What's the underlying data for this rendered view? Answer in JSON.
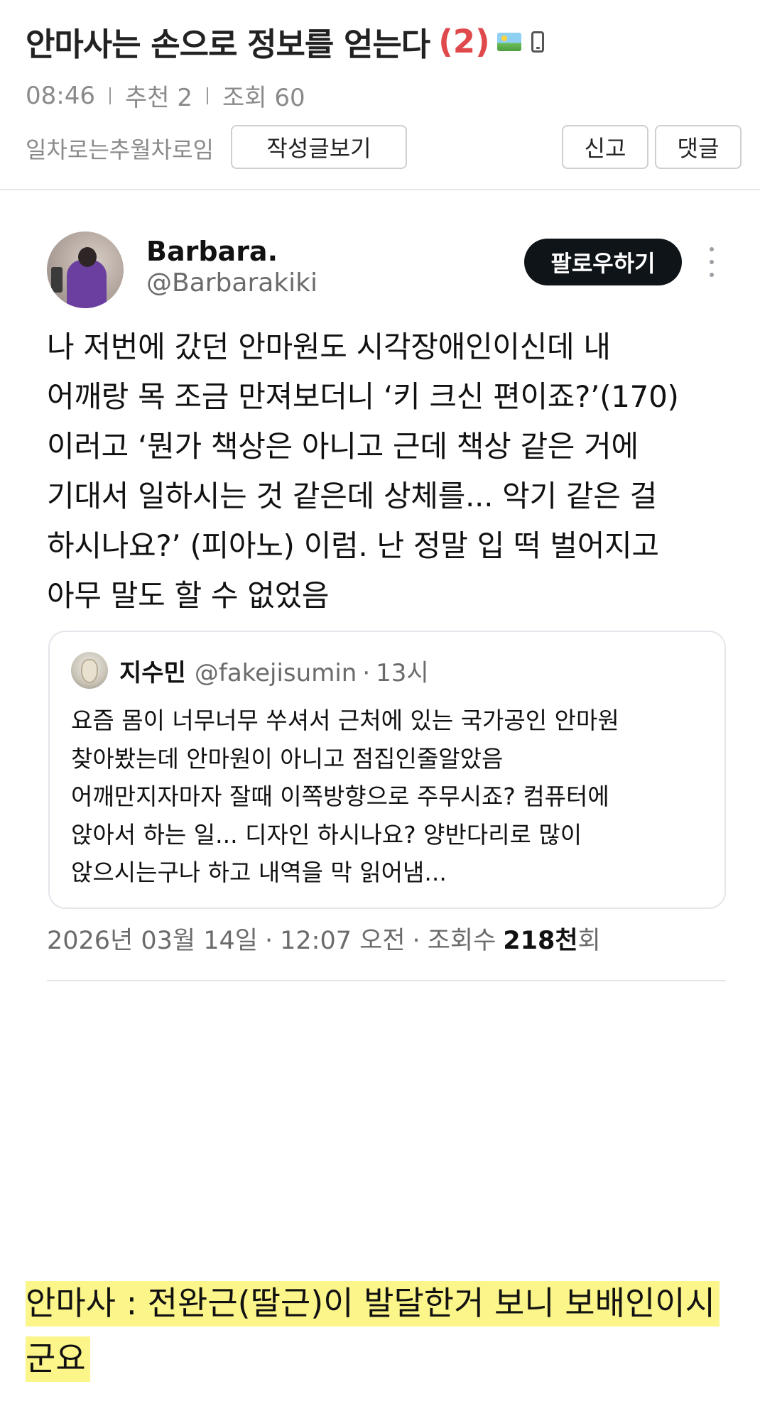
{
  "post": {
    "title": "안마사는 손으로 정보를 얻는다",
    "comment_count": "(2)",
    "title_icons": [
      "image-icon",
      "mobile-icon"
    ],
    "time": "08:46",
    "recommend": "추천 2",
    "views": "조회 60",
    "author": "일차로는추월차로임",
    "buttons": {
      "view_posts": "작성글보기",
      "report": "신고",
      "comment": "댓글"
    }
  },
  "tweet": {
    "display_name": "Barbara.",
    "handle": "@Barbarakiki",
    "follow_label": "팔로우하기",
    "body_lines": [
      "나 저번에 갔던 안마원도 시각장애인이신데 내",
      "어깨랑 목 조금 만져보더니 ‘키 크신 편이죠?’(170)",
      "이러고 ‘뭔가 책상은 아니고 근데 책상 같은 거에",
      "기대서 일하시는 것 같은데 상체를... 악기 같은 걸",
      "하시나요?’ (피아노) 이럼. 난 정말 입 떡 벌어지고",
      "아무 말도 할 수 없었음"
    ],
    "quote": {
      "name": "지수민",
      "handle": "@fakejisumin",
      "separator": "·",
      "time": "13시",
      "lines": [
        "요즘 몸이 너무너무 쑤셔서 근처에 있는 국가공인 안마원",
        "찾아봤는데 안마원이 아니고 점집인줄알았음",
        "어깨만지자마자 잘때 이쪽방향으로 주무시죠? 컴퓨터에",
        "앉아서 하는 일... 디자인 하시나요? 양반다리로 많이",
        "앉으시는구나 하고 내역을 막 읽어냄..."
      ]
    },
    "meta": {
      "date": "2026년 03월 14일",
      "time": "12:07 오전",
      "views_label": "조회수",
      "views_number": "218천",
      "views_unit": "회",
      "separator": "·"
    }
  },
  "caption": {
    "line1": "안마사 : 전완근(딸근)이 발달한거 보니 보배인이시",
    "line2": "군요",
    "highlight_color": "#fbf58a"
  },
  "colors": {
    "comment_count": "#e0494c",
    "follow_bg": "#0f1419",
    "meta_gray": "#8a8a8a"
  }
}
